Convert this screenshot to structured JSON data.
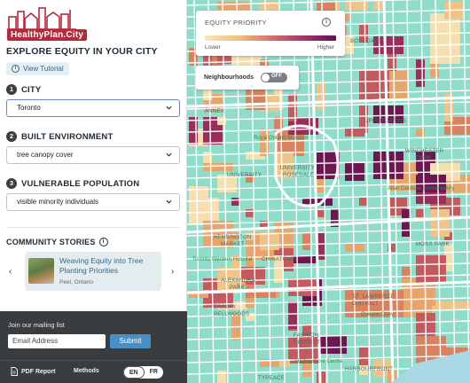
{
  "app": {
    "logo_text": "HealthyPlan.City",
    "headline": "EXPLORE EQUITY IN YOUR CITY",
    "tutorial_label": "View Tutorial"
  },
  "steps": [
    {
      "num": "1",
      "label": "CITY",
      "value": "Toronto"
    },
    {
      "num": "2",
      "label": "BUILT ENVIRONMENT",
      "value": "tree canopy cover"
    },
    {
      "num": "3",
      "label": "VULNERABLE POPULATION",
      "value": "visible minority individuals"
    }
  ],
  "stories": {
    "title": "COMMUNITY STORIES",
    "card_title": "Weaving Equity into Tree Planting Priorities",
    "card_location": "Peel, Ontario",
    "prev": "‹",
    "next": "›"
  },
  "footer": {
    "mailing_label": "Join our mailing list",
    "email_placeholder": "Email Address",
    "submit_label": "Submit",
    "pdf_label": "PDF Report",
    "methods_label": "Methods",
    "lang_en": "EN",
    "lang_fr": "FR"
  },
  "legend": {
    "title": "EQUITY PRIORITY",
    "low": "Lower",
    "high": "Higher",
    "info": "i"
  },
  "neighbourhoods": {
    "label": "Neighbourhoods",
    "toggle_text": "OFF"
  },
  "map_labels": {
    "bosedale": "BOSEDALE",
    "annex": "ANNEX",
    "upper_jarvis": "UPPER JARVIS",
    "royal_ontario": "Royal Ontario Museum",
    "university": "UNIVERSITY",
    "rosedale": "ROSEDALE",
    "winchester": "WINCHESTER",
    "park": "PARK",
    "university2": "UNIVERSITY",
    "allan_gardens": "Allan Gardens Conservatory",
    "kensington": "KENSINGTON",
    "market": "MARKET",
    "moss_park": "MOSS PARK",
    "toronto_western": "Toronto Western Hospital",
    "chinatown": "CHINATOWN",
    "alexandra": "ALEXANDRA",
    "park2": "PARK",
    "st_lawrence": "ST. LAWRENCE",
    "district": "DISTRICT",
    "harbourfront": "HARBOURFRONT",
    "trinity": "TRINITY",
    "bellwoods": "BELLWOODS",
    "fashion": "FASHION",
    "district2": "DISTRICT",
    "typeace": "TYPEACE",
    "market2": "MARKET",
    "harbourfront2": "HARBOURFRONT",
    "queens_quay": "Queens Quay",
    "harbourfront_centre": "Harbourfront Centre"
  },
  "colors": {
    "map_bg": "#8fdcc8",
    "grid": "#ffffff",
    "low": "#f7e6bf",
    "mid": "#e8a468",
    "high": "#5e1452",
    "sidebar_footer": "#3a3d40",
    "accent": "#2f6b8a"
  }
}
